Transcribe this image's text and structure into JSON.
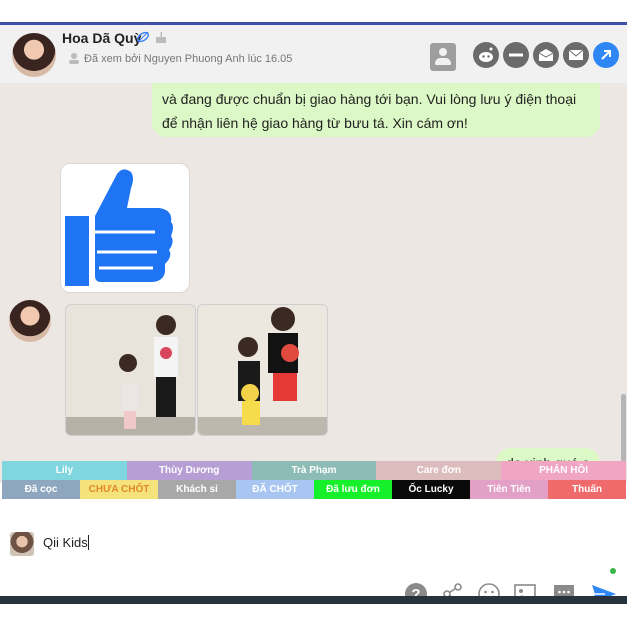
{
  "header": {
    "contact_name": "Hoa Dã Quỳ",
    "seen_status": "Đã xem bởi Nguyen Phuong Anh lúc 16.05"
  },
  "messages": {
    "shop_message_lines": [
      "và đang được chuẩn bị giao hàng tới bạn. Vui lòng lưu ý điện thoại",
      "để nhận liên hệ giao hàng từ bưu tá. Xin cám ơn!"
    ],
    "reply_text": "dạ xinh quá ạ"
  },
  "tags_row1": [
    {
      "label": "Lily",
      "color": "#7fd6de"
    },
    {
      "label": "Thùy Dương",
      "color": "#b79fd6"
    },
    {
      "label": "Trà Phạm",
      "color": "#8cbcb5"
    },
    {
      "label": "Care đơn",
      "color": "#dcbcbc"
    },
    {
      "label": "PHẢN HỒI",
      "color": "#f0a6c3"
    }
  ],
  "tags_row2": [
    {
      "label": "Đã cọc",
      "color": "#8fa7be"
    },
    {
      "label": "CHƯA CHỐT",
      "color": "#f5e27a"
    },
    {
      "label": "Khách sỉ",
      "color": "#a8a8a8"
    },
    {
      "label": "ĐÃ CHỐT",
      "color": "#a9c6f2"
    },
    {
      "label": "Đã lưu đơn",
      "color": "#16f02a"
    },
    {
      "label": "Ốc Lucky",
      "color": "#0a0a0a"
    },
    {
      "label": "Tiên Tiên",
      "color": "#e3a0c7"
    },
    {
      "label": "Thuấn",
      "color": "#ef6b6b"
    }
  ],
  "composer": {
    "input_value": "Qii Kids"
  },
  "colors": {
    "accent_blue": "#2f86f5",
    "bubble_green": "#dcf8c6",
    "chat_background": "#ece7e3"
  }
}
